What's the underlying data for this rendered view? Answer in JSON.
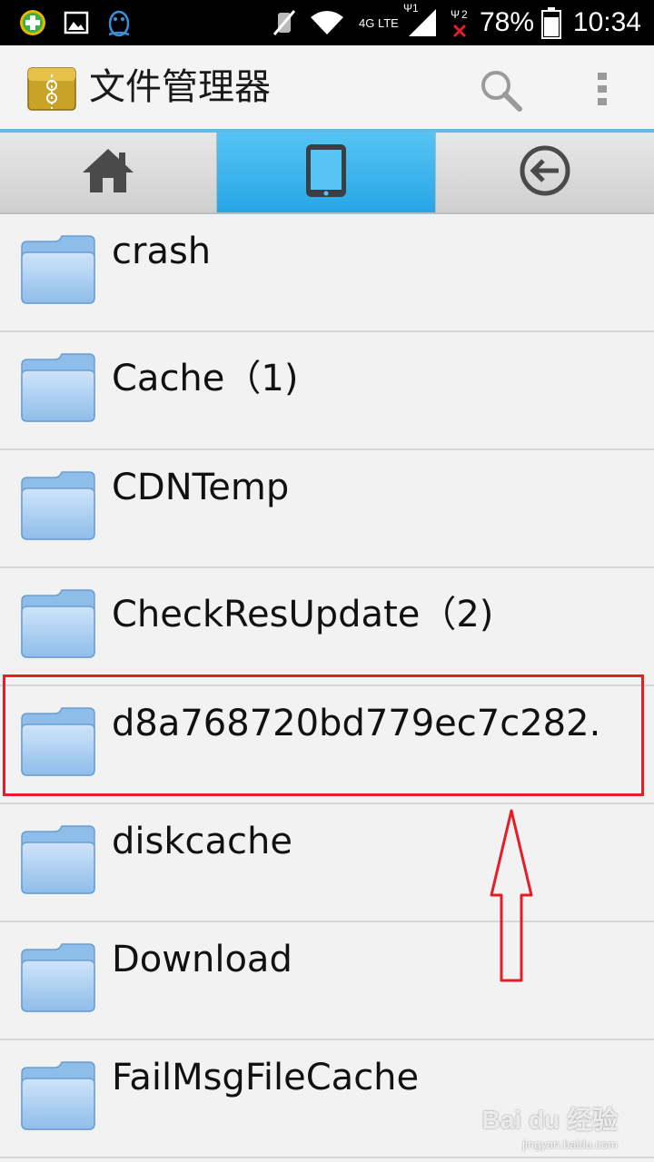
{
  "status_bar": {
    "network": "4G LTE",
    "sim1": "1",
    "sim2": "2",
    "battery": "78%",
    "time": "10:34",
    "icons": [
      "plus-circle-icon",
      "image-icon",
      "qq-penguin-icon",
      "mute-icon",
      "wifi-icon",
      "signal-icon",
      "battery-icon"
    ]
  },
  "app_bar": {
    "title": "文件管理器",
    "icons": [
      "app-folder-icon",
      "search-icon",
      "overflow-menu-icon"
    ]
  },
  "tabs": [
    {
      "name": "home",
      "icon": "home-icon",
      "active": false
    },
    {
      "name": "device",
      "icon": "phone-icon",
      "active": true
    },
    {
      "name": "back",
      "icon": "back-arrow-icon",
      "active": false
    }
  ],
  "files": [
    {
      "name": "crash"
    },
    {
      "name": "Cache（1)"
    },
    {
      "name": "CDNTemp"
    },
    {
      "name": "CheckResUpdate（2)"
    },
    {
      "name": "d8a768720bd779ec7c282."
    },
    {
      "name": "diskcache"
    },
    {
      "name": "Download"
    },
    {
      "name": "FailMsgFileCache"
    }
  ],
  "annotation": {
    "highlight_color": "#e21f26",
    "highlighted_item_index": 4
  },
  "watermark": {
    "brand": "Bai du 经验",
    "url": "jingyan.baidu.com"
  }
}
